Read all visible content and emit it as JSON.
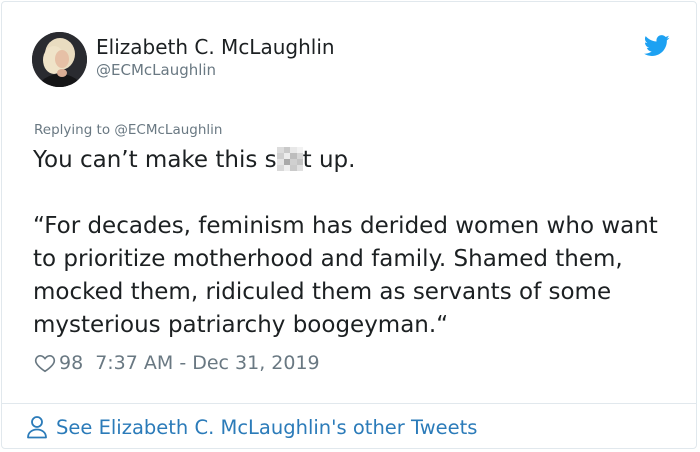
{
  "author": {
    "name": "Elizabeth C. McLaughlin",
    "handle": "@ECMcLaughlin"
  },
  "reply": {
    "prefix": "Replying to ",
    "handle": "@ECMcLaughlin"
  },
  "tweet": {
    "line1_before": "You can’t make this s",
    "line1_after": "t up.",
    "quote": "“For decades, feminism has derided women who want to prioritize motherhood and family. Shamed them, mocked them, ridiculed them as servants of some mysterious patriarchy boogeyman.“"
  },
  "meta": {
    "likes": "98",
    "timestamp": "7:37 AM - Dec 31, 2019"
  },
  "footer": {
    "link_text": "See Elizabeth C. McLaughlin's other Tweets"
  },
  "colors": {
    "text": "#1c2022",
    "muted": "#697882",
    "link": "#2b7bb9",
    "twitter_blue": "#1da1f2",
    "border": "#e1e8ed"
  },
  "icons": [
    "avatar-photo",
    "twitter-bird-icon",
    "heart-icon",
    "person-icon",
    "censor-pixelation"
  ]
}
